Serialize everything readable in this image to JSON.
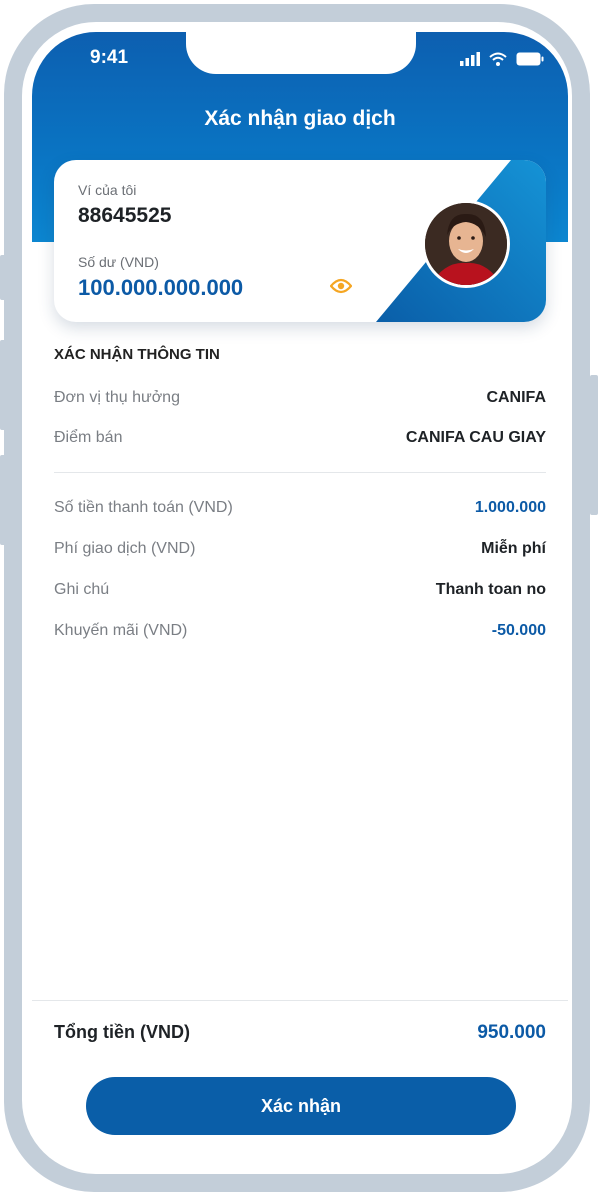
{
  "status_bar": {
    "time": "9:41"
  },
  "header": {
    "title": "Xác nhận giao dịch"
  },
  "wallet_card": {
    "wallet_label": "Ví của tôi",
    "wallet_id": "88645525",
    "balance_label": "Số dư (VND)",
    "balance_value": "100.000.000.000"
  },
  "confirm_info": {
    "section_title": "XÁC NHẬN THÔNG TIN",
    "rows": [
      {
        "label": "Đơn vị thụ hưởng",
        "value": "CANIFA"
      },
      {
        "label": "Điểm bán",
        "value": "CANIFA CAU GIAY"
      },
      {
        "label": "Số tiền thanh toán (VND)",
        "value": "1.000.000"
      },
      {
        "label": "Phí giao dịch (VND)",
        "value": "Miễn phí"
      },
      {
        "label": "Ghi chú",
        "value": "Thanh toan no"
      },
      {
        "label": "Khuyến mãi (VND)",
        "value": "-50.000"
      }
    ]
  },
  "total": {
    "label": "Tổng tiền (VND)",
    "value": "950.000"
  },
  "actions": {
    "confirm_label": "Xác nhận"
  },
  "colors": {
    "primary": "#0a5ea8",
    "accent_eye": "#f5a623",
    "frame": "#c3ced9"
  }
}
